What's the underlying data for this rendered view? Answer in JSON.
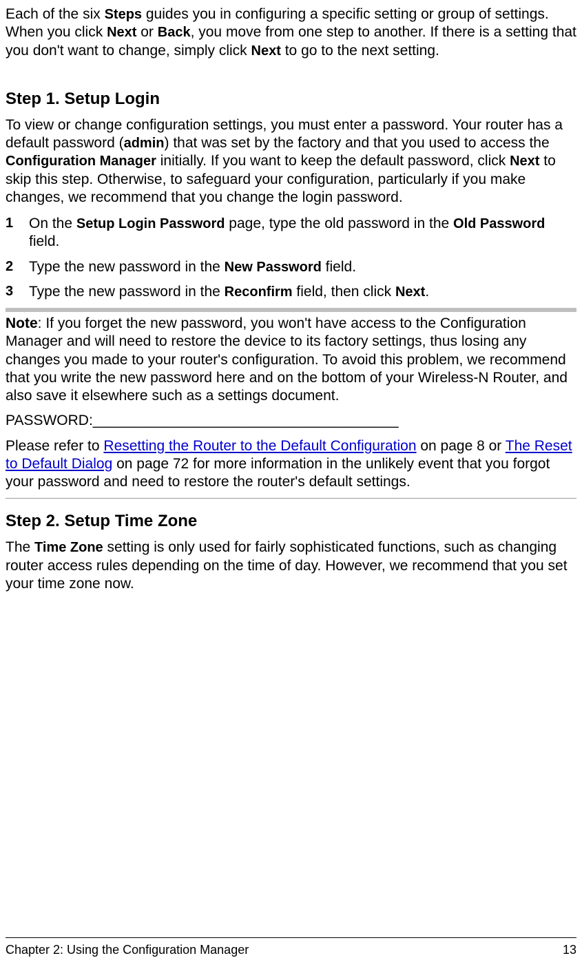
{
  "intro": {
    "part1": "Each of the six ",
    "steps": "Steps",
    "part2": " guides you in configuring a specific setting or group of settings. When you click ",
    "next1": "Next",
    "part3": " or ",
    "back": "Back",
    "part4": ", you move from one step to another. If there is a setting that you don't want to change, simply click ",
    "next2": "Next",
    "part5": " to go to the next setting."
  },
  "step1": {
    "heading": "Step 1. Setup Login",
    "p1a": "To view or change configuration settings, you must enter a password. Your router has a default password (",
    "admin": "admin",
    "p1b": ") that was set by the factory and that you used to access the ",
    "cfgmgr": "Configuration Manager",
    "p1c": " initially. If you want to keep the default password, click ",
    "next": "Next",
    "p1d": " to skip this step. Otherwise, to safeguard your configuration, particularly if you make changes, we recommend that you change the login password.",
    "li1a": "On the ",
    "li1b": "Setup Login Password",
    "li1c": " page, type the old password in the ",
    "li1d": "Old Password",
    "li1e": " field.",
    "li2a": "Type the new password in the ",
    "li2b": "New Password",
    "li2c": " field.",
    "li3a": "Type the new password in the ",
    "li3b": "Reconfirm",
    "li3c": " field, then click ",
    "li3d": "Next",
    "li3e": "."
  },
  "note": {
    "label": "Note",
    "body": ": If you forget the new password, you won't have access to the Configuration Manager and will need to restore the device to its factory settings, thus losing any changes you made to your router's configuration. To avoid this problem, we recommend that you write the new password here and on the bottom of your Wireless-N Router, and also save it elsewhere such as a settings document.",
    "password_line": "PASSWORD:______________________________________",
    "ref1": "Please refer to ",
    "link1": "Resetting the Router to the Default Configuration",
    "ref2": " on page 8 or ",
    "link2": "The Reset to Default Dialog",
    "ref3": " on page 72 for more information in the unlikely event that you forgot your password and need to restore the router's default settings."
  },
  "step2": {
    "heading": "Step 2. Setup Time Zone",
    "p1a": "The ",
    "tz": "Time Zone",
    "p1b": " setting is only used for fairly sophisticated functions, such as changing router access rules depending on the time of day. However, we recommend that you set your time zone now."
  },
  "footer": {
    "chapter": "Chapter 2: Using the Configuration Manager",
    "page": "13"
  }
}
